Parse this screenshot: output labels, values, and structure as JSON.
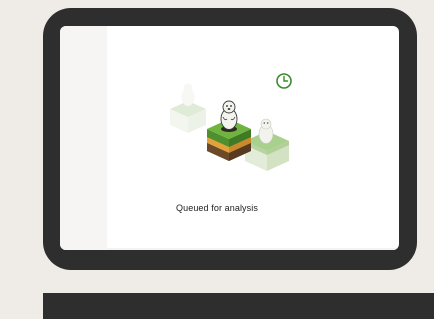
{
  "status": {
    "message": "Queued for analysis"
  },
  "icons": {
    "clock": "clock-icon",
    "box_center": "marmot-soil-box-icon",
    "box_left": "marmot-box-faded-icon",
    "box_right": "marmot-box-light-icon"
  },
  "colors": {
    "background": "#efebe6",
    "device_frame": "#2e2e2e",
    "screen": "#ffffff",
    "accent_green": "#3a8a2e",
    "soil_brown": "#6b4a2b"
  }
}
